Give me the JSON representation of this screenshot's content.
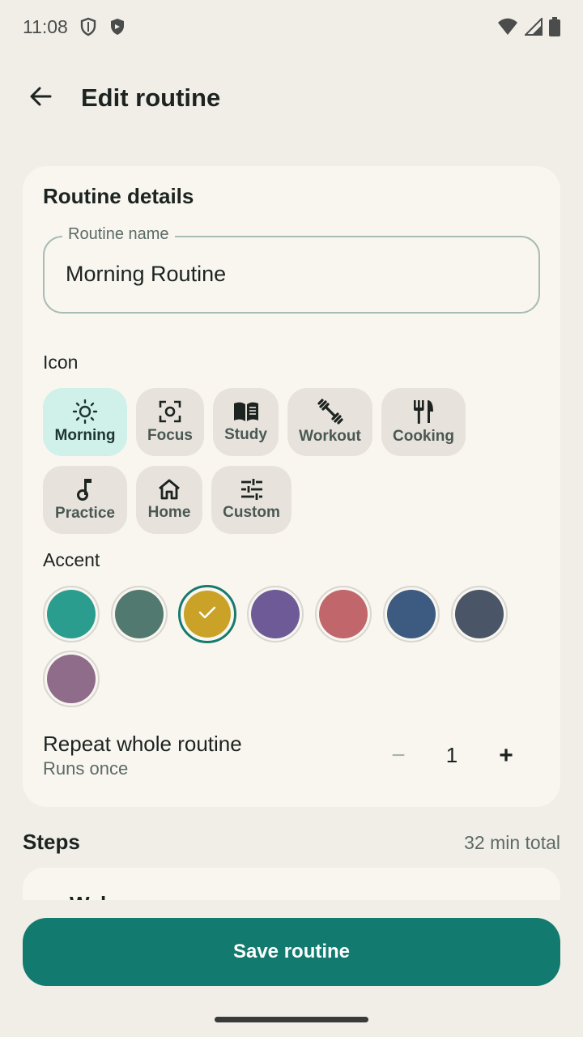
{
  "status_bar": {
    "time": "11:08",
    "icons": [
      "shield-outline-icon",
      "shield-filled-icon",
      "wifi-icon",
      "signal-icon",
      "battery-icon"
    ]
  },
  "app_bar": {
    "back_icon": "arrow-back-icon",
    "title": "Edit routine"
  },
  "details": {
    "title": "Routine details",
    "name_field": {
      "label": "Routine name",
      "value": "Morning Routine"
    },
    "icon_label": "Icon",
    "icons": [
      {
        "label": "Morning",
        "icon": "sun-icon",
        "selected": true
      },
      {
        "label": "Focus",
        "icon": "focus-icon",
        "selected": false
      },
      {
        "label": "Study",
        "icon": "book-icon",
        "selected": false
      },
      {
        "label": "Workout",
        "icon": "dumbbell-icon",
        "selected": false
      },
      {
        "label": "Cooking",
        "icon": "fork-knife-icon",
        "selected": false
      },
      {
        "label": "Practice",
        "icon": "music-note-icon",
        "selected": false
      },
      {
        "label": "Home",
        "icon": "home-icon",
        "selected": false
      },
      {
        "label": "Custom",
        "icon": "sliders-icon",
        "selected": false
      }
    ],
    "accent_label": "Accent",
    "accents": [
      {
        "color": "#2a9d8f",
        "selected": false
      },
      {
        "color": "#52796f",
        "selected": false
      },
      {
        "color": "#c9a227",
        "selected": true
      },
      {
        "color": "#6d5a96",
        "selected": false
      },
      {
        "color": "#c1666b",
        "selected": false
      },
      {
        "color": "#3d5a80",
        "selected": false
      },
      {
        "color": "#4a5568",
        "selected": false
      },
      {
        "color": "#8e6c8a",
        "selected": false
      }
    ],
    "repeat": {
      "title": "Repeat whole routine",
      "subtitle": "Runs once",
      "minus": "−",
      "value": "1",
      "plus": "+"
    }
  },
  "steps": {
    "title": "Steps",
    "total": "32 min total",
    "first_step_partial": "Wake"
  },
  "save_button": "Save routine",
  "colors": {
    "background": "#f1eee8",
    "card": "#f9f6f0",
    "primary": "#127a6e",
    "chip": "#e7e3dc",
    "chip_selected": "#d0f0ea"
  }
}
